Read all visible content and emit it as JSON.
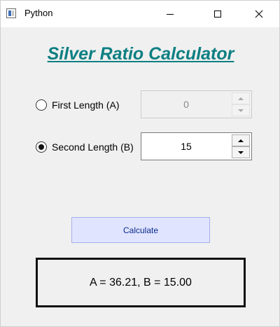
{
  "window": {
    "title": "Python",
    "controls": {
      "minimize": "minimize",
      "maximize": "maximize",
      "close": "close"
    }
  },
  "heading": "Silver Ratio Calculator",
  "inputs": {
    "first_length": {
      "label": "First Length (A)",
      "value": "0",
      "selected": false,
      "enabled": false
    },
    "second_length": {
      "label": "Second Length (B)",
      "value": "15",
      "selected": true,
      "enabled": true
    }
  },
  "calculate_button": "Calculate",
  "result": "A = 36.21, B = 15.00",
  "colors": {
    "heading": "#0d7f82",
    "button_bg": "#e0e4ff",
    "button_text": "#0a2a8a"
  }
}
